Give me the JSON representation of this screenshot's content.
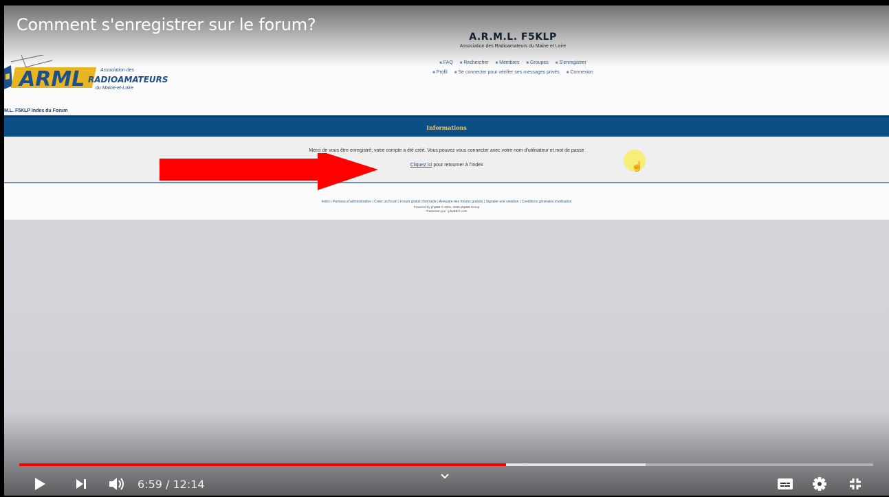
{
  "video": {
    "title": "Comment s'enregistrer sur le forum?",
    "current_time": "6:59",
    "duration": "12:14",
    "time_display": "6:59 / 12:14",
    "progress_fraction": 0.5698,
    "buffered_fraction": 0.7335
  },
  "site": {
    "title": "A.R.M.L. F5KLP",
    "subtitle": "Association des Radioamateurs du Maine et Loire",
    "logo_lines": [
      "Association des",
      "RADIOAMATEURS",
      "du Maine-et-Loire"
    ],
    "logo_mark": "ARML",
    "nav_row1": [
      "FAQ",
      "Rechercher",
      "Membres",
      "Groupes",
      "S'enregistrer"
    ],
    "nav_row2": [
      "Profil",
      "Se connecter pour vérifier ses messages privés",
      "Connexion"
    ],
    "breadcrumb": "M.L. F5KLP Index du Forum",
    "info_title": "Informations",
    "message": "Merci de vous être enregistré; votre compte a été créé. Vous pouvez vous connecter avec votre nom d'utilisateur et mot de passe",
    "link_text": "Cliquez ici",
    "link_suffix": " pour retourner à l'Index",
    "footer_links": "Index | Panneau d'administration | Créer un forum | Forum gratuit d'entraide | Annuaire des forums gratuits | Signaler une violation | Conditions générales d'utilisation",
    "footer_powered": "Powered by phpBB © 2001, 2005 phpBB Group",
    "footer_translation": "Traduction par : phpBB-fr.com"
  },
  "colors": {
    "progress": "#ff0000",
    "arrow": "#ff0000",
    "info_bar": "#0b4f86"
  },
  "icons": [
    "play-icon",
    "next-icon",
    "volume-icon",
    "chevron-down-icon",
    "subtitles-icon",
    "settings-icon",
    "exit-fullscreen-icon"
  ]
}
